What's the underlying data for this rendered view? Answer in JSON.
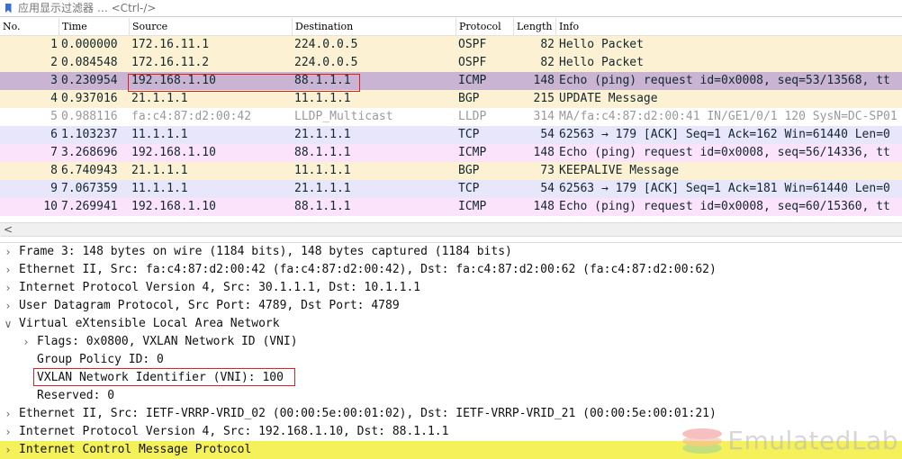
{
  "filter": {
    "placeholder": "应用显示过滤器 … <Ctrl-/>"
  },
  "columns": {
    "no": "No.",
    "time": "Time",
    "source": "Source",
    "destination": "Destination",
    "protocol": "Protocol",
    "length": "Length",
    "info": "Info"
  },
  "packets": [
    {
      "no": "1",
      "time": "0.000000",
      "source": "172.16.11.1",
      "destination": "224.0.0.5",
      "protocol": "OSPF",
      "length": "82",
      "info": "Hello Packet",
      "bg": "#fdf1d3"
    },
    {
      "no": "2",
      "time": "0.084548",
      "source": "172.16.11.2",
      "destination": "224.0.0.5",
      "protocol": "OSPF",
      "length": "82",
      "info": "Hello Packet",
      "bg": "#fdf1d3"
    },
    {
      "no": "3",
      "time": "0.230954",
      "source": "192.168.1.10",
      "destination": "88.1.1.1",
      "protocol": "ICMP",
      "length": "148",
      "info": "Echo (ping) request  id=0x0008, seq=53/13568, tt",
      "bg": "#c9b4d3"
    },
    {
      "no": "4",
      "time": "0.937016",
      "source": "21.1.1.1",
      "destination": "11.1.1.1",
      "protocol": "BGP",
      "length": "215",
      "info": "UPDATE Message",
      "bg": "#fdf1d3"
    },
    {
      "no": "5",
      "time": "0.988116",
      "source": "fa:c4:87:d2:00:42",
      "destination": "LLDP_Multicast",
      "protocol": "LLDP",
      "length": "314",
      "info": "MA/fa:c4:87:d2:00:41 IN/GE1/0/1 120 SysN=DC-SP01",
      "bg": "#ffffff"
    },
    {
      "no": "6",
      "time": "1.103237",
      "source": "11.1.1.1",
      "destination": "21.1.1.1",
      "protocol": "TCP",
      "length": "54",
      "info": "62563 → 179 [ACK] Seq=1 Ack=162 Win=61440 Len=0",
      "bg": "#e8e6fb"
    },
    {
      "no": "7",
      "time": "3.268696",
      "source": "192.168.1.10",
      "destination": "88.1.1.1",
      "protocol": "ICMP",
      "length": "148",
      "info": "Echo (ping) request  id=0x0008, seq=56/14336, tt",
      "bg": "#fbe3fb"
    },
    {
      "no": "8",
      "time": "6.740943",
      "source": "21.1.1.1",
      "destination": "11.1.1.1",
      "protocol": "BGP",
      "length": "73",
      "info": "KEEPALIVE Message",
      "bg": "#fdf1d3"
    },
    {
      "no": "9",
      "time": "7.067359",
      "source": "11.1.1.1",
      "destination": "21.1.1.1",
      "protocol": "TCP",
      "length": "54",
      "info": "62563 → 179 [ACK] Seq=1 Ack=181 Win=61440 Len=0",
      "bg": "#e8e6fb"
    },
    {
      "no": "10",
      "time": "7.269941",
      "source": "192.168.1.10",
      "destination": "88.1.1.1",
      "protocol": "ICMP",
      "length": "148",
      "info": "Echo (ping) request  id=0x0008, seq=60/15360, tt",
      "bg": "#fbe3fb"
    }
  ],
  "scroll_left_icon": "chevron-left-icon",
  "details": [
    {
      "text": "Frame 3: 148 bytes on wire (1184 bits), 148 bytes captured (1184 bits)",
      "level": 0,
      "expander": "collapsed"
    },
    {
      "text": "Ethernet II, Src: fa:c4:87:d2:00:42 (fa:c4:87:d2:00:42), Dst: fa:c4:87:d2:00:62 (fa:c4:87:d2:00:62)",
      "level": 0,
      "expander": "collapsed"
    },
    {
      "text": "Internet Protocol Version 4, Src: 30.1.1.1, Dst: 10.1.1.1",
      "level": 0,
      "expander": "collapsed"
    },
    {
      "text": "User Datagram Protocol, Src Port: 4789, Dst Port: 4789",
      "level": 0,
      "expander": "collapsed"
    },
    {
      "text": "Virtual eXtensible Local Area Network",
      "level": 0,
      "expander": "expanded"
    },
    {
      "text": "Flags: 0x0800, VXLAN Network ID (VNI)",
      "level": 1,
      "expander": "collapsed"
    },
    {
      "text": "Group Policy ID: 0",
      "level": 1,
      "expander": "none"
    },
    {
      "text": "VXLAN Network Identifier (VNI): 100",
      "level": 1,
      "expander": "none"
    },
    {
      "text": "Reserved: 0",
      "level": 1,
      "expander": "none"
    },
    {
      "text": "Ethernet II, Src: IETF-VRRP-VRID_02 (00:00:5e:00:01:02), Dst: IETF-VRRP-VRID_21 (00:00:5e:00:01:21)",
      "level": 0,
      "expander": "collapsed"
    },
    {
      "text": "Internet Protocol Version 4, Src: 192.168.1.10, Dst: 88.1.1.1",
      "level": 0,
      "expander": "collapsed"
    },
    {
      "text": "Internet Control Message Protocol",
      "level": 0,
      "expander": "collapsed",
      "selected": true
    }
  ],
  "annotations": {
    "box_color": "#e02020"
  },
  "watermark": {
    "text": "EmulatedLab"
  }
}
